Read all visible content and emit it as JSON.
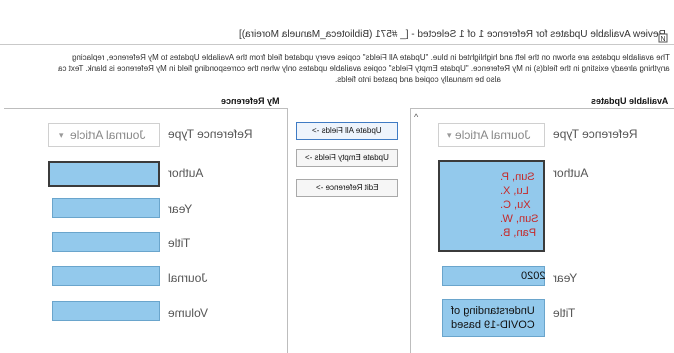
{
  "window": {
    "title": "Review Available Updates for Reference 1 of 1 Selected - [_ #571 (Biblioteca_Manuela Moreira)]"
  },
  "description": {
    "lines": [
      "The available updates are shown on the left and highlighted in blue. \"Update All Fields\" copies every updated field from the Available Updates to My Reference, replacing",
      "anything already existing in the field(s) in My Reference. \"Update Empty Fields\" copies available updates only when the corresponding field in My Reference is blank. Text ca",
      "also be manually copied and pasted into fields."
    ]
  },
  "available_updates": {
    "header": "Available Updates",
    "reference_type_label": "Reference Type",
    "reference_type_value": "Journal Article",
    "author_label": "Author",
    "authors": [
      "Sun, P.",
      "Lu, X.",
      "Xu, C.",
      "Sun, W.",
      "Pan, B."
    ],
    "year_label": "Year",
    "year_value": "2020",
    "title_label": "Title",
    "title_value": [
      "Understanding of",
      "COVID-19 based"
    ]
  },
  "actions": {
    "update_all": "Update All Fields ->",
    "update_empty": "Update Empty Fields ->",
    "edit_reference": "Edit Reference ->"
  },
  "my_reference": {
    "header": "My Reference",
    "reference_type_label": "Reference Type",
    "reference_type_value": "Journal Article",
    "fields": [
      {
        "label": "Author"
      },
      {
        "label": "Year"
      },
      {
        "label": "Title"
      },
      {
        "label": "Journal"
      },
      {
        "label": "Volume"
      }
    ]
  },
  "icons": {
    "window_icon": "endnote-icon",
    "dropdown": "chevron-down-icon",
    "scroll": "scroll-up-arrow-icon"
  },
  "colors": {
    "field_fill": "#93c9ec",
    "author_text": "#c62828",
    "primary_button_border": "#3f7bc4"
  }
}
